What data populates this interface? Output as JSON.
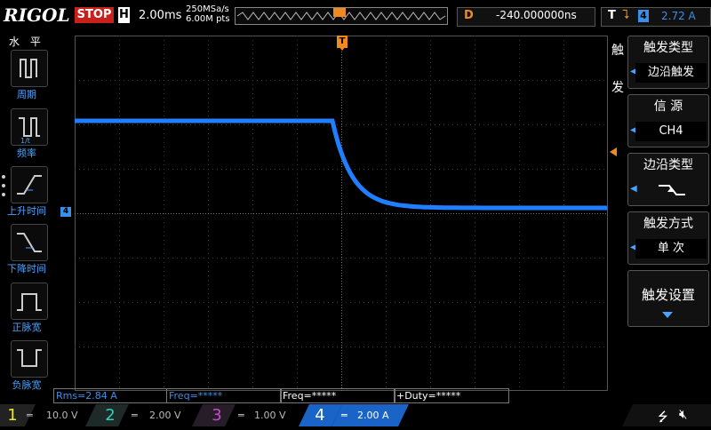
{
  "brand": "RIGOL",
  "status": "STOP",
  "timebase": {
    "label": "H",
    "value": "2.00ms"
  },
  "sample": {
    "rate": "250MSa/s",
    "points": "6.00M pts"
  },
  "delay": {
    "label": "D",
    "value": "-240.000000ns"
  },
  "trigger_status": {
    "label": "T",
    "channel": "4",
    "level": "2.72 A"
  },
  "left_menu": {
    "title": "水 平",
    "items": [
      {
        "label": "周期",
        "icon": "period-icon"
      },
      {
        "label": "频率",
        "icon": "frequency-icon"
      },
      {
        "label": "上升时间",
        "icon": "rise-time-icon"
      },
      {
        "label": "下降时间",
        "icon": "fall-time-icon"
      },
      {
        "label": "正脉宽",
        "icon": "positive-width-icon"
      },
      {
        "label": "负脉宽",
        "icon": "negative-width-icon"
      }
    ]
  },
  "right_menu": {
    "side_title_1": "触",
    "side_title_2": "发",
    "items": [
      {
        "heading": "触发类型",
        "value": "边沿触发"
      },
      {
        "heading": "信 源",
        "value": "CH4"
      },
      {
        "heading": "边沿类型",
        "value": "falling-edge"
      },
      {
        "heading": "触发方式",
        "value": "单  次"
      },
      {
        "heading": "触发设置",
        "value": ""
      }
    ]
  },
  "markers": {
    "trigger_top": "T",
    "ch4_left": "4"
  },
  "measurements": [
    "Rms=2.84 A",
    "Freq=*****",
    "Freq=*****",
    "+Duty=*****"
  ],
  "channels": [
    {
      "num": "1",
      "scale": "10.0 V",
      "color": "#e8e822"
    },
    {
      "num": "2",
      "scale": "2.00 V",
      "color": "#2fd3b8"
    },
    {
      "num": "3",
      "scale": "1.00 V",
      "color": "#c04fc8"
    },
    {
      "num": "4",
      "scale": "2.00 A",
      "color": "#3a8fe8"
    }
  ],
  "colors": {
    "trace": "#1f7fff",
    "accent_orange": "#f08a1e",
    "grid": "#3a3a3a"
  }
}
